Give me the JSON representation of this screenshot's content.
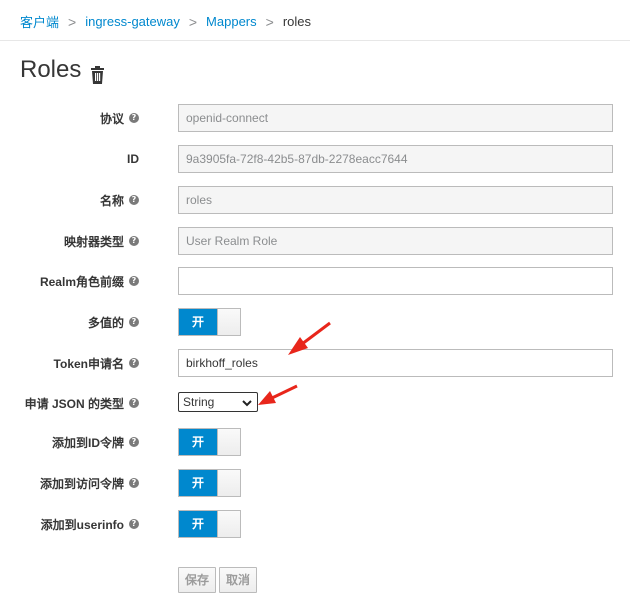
{
  "breadcrumb": {
    "items": [
      "客户端",
      "ingress-gateway",
      "Mappers"
    ],
    "current": "roles",
    "separator": ">"
  },
  "page": {
    "title": "Roles"
  },
  "form": {
    "protocol": {
      "label": "协议",
      "value": "openid-connect"
    },
    "id": {
      "label": "ID",
      "value": "9a3905fa-72f8-42b5-87db-2278eacc7644"
    },
    "name": {
      "label": "名称",
      "value": "roles"
    },
    "mapper_type": {
      "label": "映射器类型",
      "value": "User Realm Role"
    },
    "realm_role_prefix": {
      "label": "Realm角色前缀",
      "value": ""
    },
    "multivalued": {
      "label": "多值的",
      "toggle": "开",
      "on": true
    },
    "token_claim_name": {
      "label": "Token申请名",
      "value": "birkhoff_roles"
    },
    "json_type": {
      "label": "申请 JSON 的类型",
      "value": "String"
    },
    "add_to_id_token": {
      "label": "添加到ID令牌",
      "toggle": "开",
      "on": true
    },
    "add_to_access_token": {
      "label": "添加到访问令牌",
      "toggle": "开",
      "on": true
    },
    "add_to_userinfo": {
      "label": "添加到userinfo",
      "toggle": "开",
      "on": true
    }
  },
  "buttons": {
    "save": "保存",
    "cancel": "取消"
  },
  "colors": {
    "link": "#0088ce",
    "toggle_on": "#0088ce",
    "annotation": "#e8261b"
  },
  "icons": {
    "help": "question-circle-icon",
    "delete": "trash-icon",
    "select": "chevron-down-icon"
  }
}
